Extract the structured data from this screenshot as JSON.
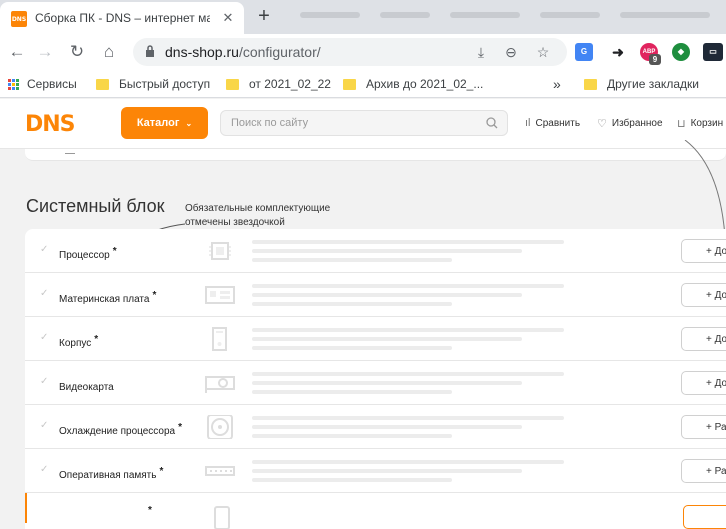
{
  "browser": {
    "tab_title": "Сборка ПК - DNS – интернет ма",
    "tab_favicon": "DNS",
    "url_host": "dns-shop.ru",
    "url_path": "/configurator/",
    "extension_badge": "9",
    "extension_abp": "ABP"
  },
  "bookmarks": {
    "services": "Сервисы",
    "items": [
      "Быстрый доступ",
      "от 2021_02_22",
      "Архив до 2021_02_..."
    ],
    "overflow": "»",
    "other": "Другие закладки"
  },
  "site": {
    "logo": "DNS",
    "catalog_label": "Каталог",
    "search_placeholder": "Поиск по сайту",
    "compare": "Сравнить",
    "favorites": "Избранное",
    "cart": "Корзин"
  },
  "configurator": {
    "section_title": "Системный блок",
    "hint_line1": "Обязательные комплектующие",
    "hint_line2": "отмечены звездочкой",
    "rows": [
      {
        "label": "Процессор",
        "required": "*",
        "button": "+ Добавить",
        "icon": "cpu-icon"
      },
      {
        "label": "Материнская плата",
        "required": "*",
        "button": "+ Добавить",
        "icon": "motherboard-icon"
      },
      {
        "label": "Корпус",
        "required": "*",
        "button": "+ Добавить",
        "icon": "case-icon"
      },
      {
        "label": "Видеокарта",
        "required": "",
        "button": "+ Добавить",
        "icon": "gpu-icon"
      },
      {
        "label": "Охлаждение процессора",
        "required": "*",
        "button": "+ Разделы",
        "icon": "cooler-icon"
      },
      {
        "label": "Оперативная память",
        "required": "*",
        "button": "+ Разделы",
        "icon": "ram-icon"
      }
    ],
    "last_row_required": "*"
  },
  "colors": {
    "accent": "#fc8507"
  }
}
